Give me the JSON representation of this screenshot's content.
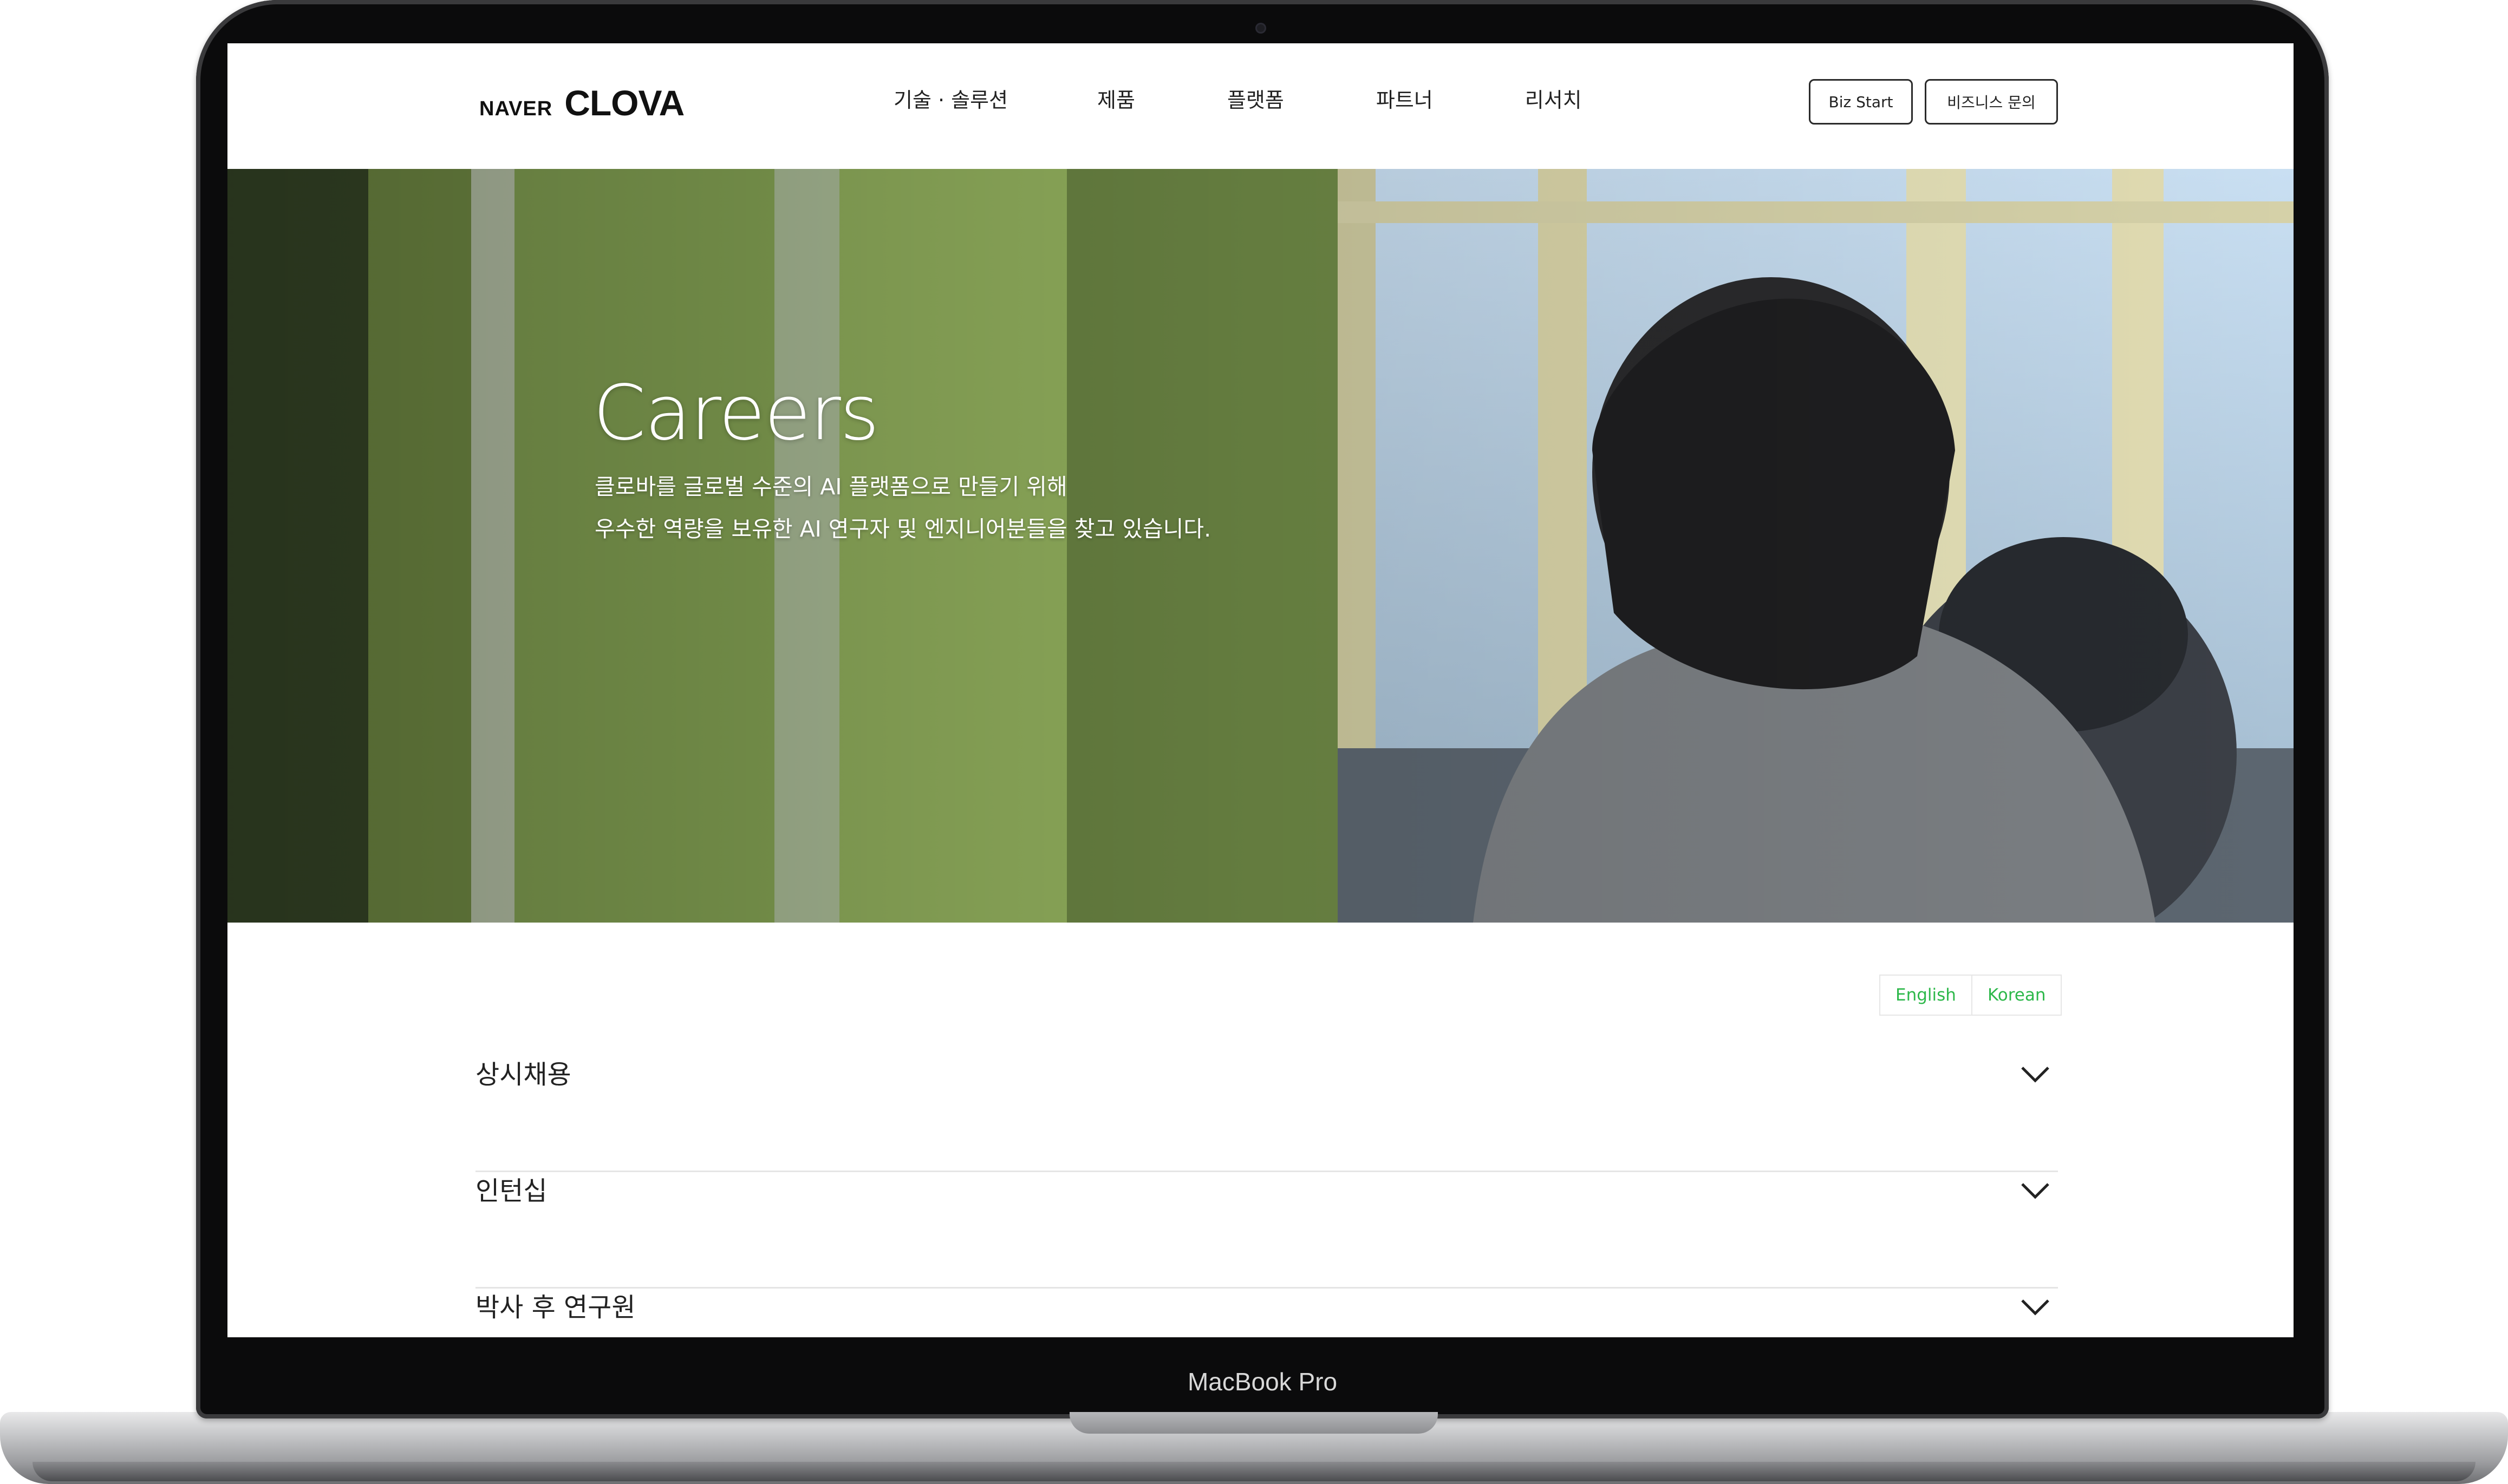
{
  "device": {
    "label": "MacBook Pro"
  },
  "header": {
    "logo": {
      "naver": "NAVER",
      "clova": "CLOVA"
    },
    "nav": [
      "기술 · 솔루션",
      "제품",
      "플랫폼",
      "파트너",
      "리서치"
    ],
    "buttons": {
      "biz_start": "Biz Start",
      "biz_contact": "비즈니스 문의"
    }
  },
  "hero": {
    "title": "Careers",
    "description": [
      "클로바를 글로벌 수준의 AI 플랫폼으로 만들기 위해",
      "우수한 역량을 보유한 AI 연구자 및 엔지니어분들을 찾고 있습니다."
    ]
  },
  "language": {
    "options": [
      "English",
      "Korean"
    ],
    "accent": "#2db84a"
  },
  "sections": [
    {
      "label": "상시채용",
      "icon": "chevron-down-icon"
    },
    {
      "label": "인턴십",
      "icon": "chevron-down-icon"
    },
    {
      "label": "박사 후 연구원",
      "icon": "chevron-down-icon"
    }
  ]
}
